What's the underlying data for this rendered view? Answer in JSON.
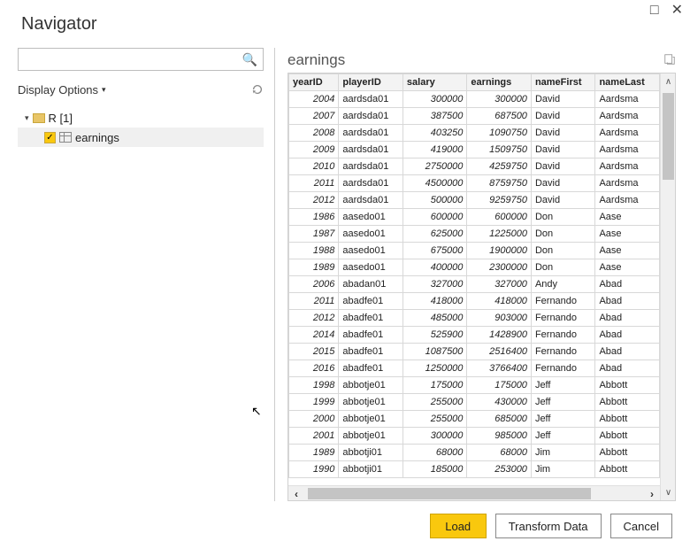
{
  "window": {
    "title": "Navigator"
  },
  "search": {
    "placeholder": ""
  },
  "displayOptions": {
    "label": "Display Options"
  },
  "tree": {
    "root": {
      "label": "R [1]"
    },
    "child": {
      "label": "earnings",
      "checked": true
    }
  },
  "preview": {
    "title": "earnings",
    "columns": [
      "yearID",
      "playerID",
      "salary",
      "earnings",
      "nameFirst",
      "nameLast"
    ],
    "rows": [
      {
        "yearID": "2004",
        "playerID": "aardsda01",
        "salary": "300000",
        "earnings": "300000",
        "nameFirst": "David",
        "nameLast": "Aardsma"
      },
      {
        "yearID": "2007",
        "playerID": "aardsda01",
        "salary": "387500",
        "earnings": "687500",
        "nameFirst": "David",
        "nameLast": "Aardsma"
      },
      {
        "yearID": "2008",
        "playerID": "aardsda01",
        "salary": "403250",
        "earnings": "1090750",
        "nameFirst": "David",
        "nameLast": "Aardsma"
      },
      {
        "yearID": "2009",
        "playerID": "aardsda01",
        "salary": "419000",
        "earnings": "1509750",
        "nameFirst": "David",
        "nameLast": "Aardsma"
      },
      {
        "yearID": "2010",
        "playerID": "aardsda01",
        "salary": "2750000",
        "earnings": "4259750",
        "nameFirst": "David",
        "nameLast": "Aardsma"
      },
      {
        "yearID": "2011",
        "playerID": "aardsda01",
        "salary": "4500000",
        "earnings": "8759750",
        "nameFirst": "David",
        "nameLast": "Aardsma"
      },
      {
        "yearID": "2012",
        "playerID": "aardsda01",
        "salary": "500000",
        "earnings": "9259750",
        "nameFirst": "David",
        "nameLast": "Aardsma"
      },
      {
        "yearID": "1986",
        "playerID": "aasedo01",
        "salary": "600000",
        "earnings": "600000",
        "nameFirst": "Don",
        "nameLast": "Aase"
      },
      {
        "yearID": "1987",
        "playerID": "aasedo01",
        "salary": "625000",
        "earnings": "1225000",
        "nameFirst": "Don",
        "nameLast": "Aase"
      },
      {
        "yearID": "1988",
        "playerID": "aasedo01",
        "salary": "675000",
        "earnings": "1900000",
        "nameFirst": "Don",
        "nameLast": "Aase"
      },
      {
        "yearID": "1989",
        "playerID": "aasedo01",
        "salary": "400000",
        "earnings": "2300000",
        "nameFirst": "Don",
        "nameLast": "Aase"
      },
      {
        "yearID": "2006",
        "playerID": "abadan01",
        "salary": "327000",
        "earnings": "327000",
        "nameFirst": "Andy",
        "nameLast": "Abad"
      },
      {
        "yearID": "2011",
        "playerID": "abadfe01",
        "salary": "418000",
        "earnings": "418000",
        "nameFirst": "Fernando",
        "nameLast": "Abad"
      },
      {
        "yearID": "2012",
        "playerID": "abadfe01",
        "salary": "485000",
        "earnings": "903000",
        "nameFirst": "Fernando",
        "nameLast": "Abad"
      },
      {
        "yearID": "2014",
        "playerID": "abadfe01",
        "salary": "525900",
        "earnings": "1428900",
        "nameFirst": "Fernando",
        "nameLast": "Abad"
      },
      {
        "yearID": "2015",
        "playerID": "abadfe01",
        "salary": "1087500",
        "earnings": "2516400",
        "nameFirst": "Fernando",
        "nameLast": "Abad"
      },
      {
        "yearID": "2016",
        "playerID": "abadfe01",
        "salary": "1250000",
        "earnings": "3766400",
        "nameFirst": "Fernando",
        "nameLast": "Abad"
      },
      {
        "yearID": "1998",
        "playerID": "abbotje01",
        "salary": "175000",
        "earnings": "175000",
        "nameFirst": "Jeff",
        "nameLast": "Abbott"
      },
      {
        "yearID": "1999",
        "playerID": "abbotje01",
        "salary": "255000",
        "earnings": "430000",
        "nameFirst": "Jeff",
        "nameLast": "Abbott"
      },
      {
        "yearID": "2000",
        "playerID": "abbotje01",
        "salary": "255000",
        "earnings": "685000",
        "nameFirst": "Jeff",
        "nameLast": "Abbott"
      },
      {
        "yearID": "2001",
        "playerID": "abbotje01",
        "salary": "300000",
        "earnings": "985000",
        "nameFirst": "Jeff",
        "nameLast": "Abbott"
      },
      {
        "yearID": "1989",
        "playerID": "abbotji01",
        "salary": "68000",
        "earnings": "68000",
        "nameFirst": "Jim",
        "nameLast": "Abbott"
      },
      {
        "yearID": "1990",
        "playerID": "abbotji01",
        "salary": "185000",
        "earnings": "253000",
        "nameFirst": "Jim",
        "nameLast": "Abbott"
      }
    ]
  },
  "buttons": {
    "load": "Load",
    "transform": "Transform Data",
    "cancel": "Cancel"
  }
}
